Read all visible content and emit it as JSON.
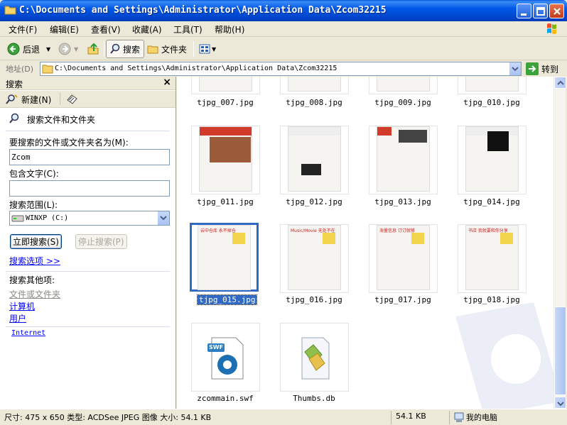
{
  "window": {
    "title": "C:\\Documents and Settings\\Administrator\\Application Data\\Zcom32215",
    "title_color": "#0058E6"
  },
  "menu": {
    "items": [
      "文件(F)",
      "编辑(E)",
      "查看(V)",
      "收藏(A)",
      "工具(T)",
      "帮助(H)"
    ]
  },
  "toolbar": {
    "back_label": "后退",
    "search_label": "搜索",
    "folders_label": "文件夹"
  },
  "address": {
    "label": "地址(D)",
    "value": "C:\\Documents and Settings\\Administrator\\Application Data\\Zcom32215",
    "go_label": "转到"
  },
  "search_pane": {
    "title": "搜索",
    "new_label": "新建(N)",
    "section_title": "搜索文件和文件夹",
    "filename_label": "要搜索的文件或文件夹名为(M):",
    "filename_value": "Zcom",
    "contains_label": "包含文字(C):",
    "contains_value": "",
    "scope_label": "搜索范围(L):",
    "scope_value": "WINXP (C:)",
    "search_button": "立即搜索(S)",
    "stop_button": "停止搜索(P)",
    "options_link": "搜索选项 >>",
    "other_title": "搜索其他项:",
    "other_items": [
      "文件或文件夹",
      "计算机",
      "用户"
    ],
    "internet_link": "Internet"
  },
  "files": [
    {
      "name": "tjpg_007.jpg",
      "kind": "jpg-cropped"
    },
    {
      "name": "tjpg_008.jpg",
      "kind": "jpg-cropped"
    },
    {
      "name": "tjpg_009.jpg",
      "kind": "jpg-cropped"
    },
    {
      "name": "tjpg_010.jpg",
      "kind": "jpg-cropped"
    },
    {
      "name": "tjpg_011.jpg",
      "kind": "jpg"
    },
    {
      "name": "tjpg_012.jpg",
      "kind": "jpg"
    },
    {
      "name": "tjpg_013.jpg",
      "kind": "jpg"
    },
    {
      "name": "tjpg_014.jpg",
      "kind": "jpg"
    },
    {
      "name": "tjpg_015.jpg",
      "kind": "jpg",
      "selected": true,
      "headline": "云中仓库 永不掉仓"
    },
    {
      "name": "tjpg_016.jpg",
      "kind": "jpg",
      "headline": "Music/Movie 无处不在"
    },
    {
      "name": "tjpg_017.jpg",
      "kind": "jpg",
      "headline": "海量信息 订订就够"
    },
    {
      "name": "tjpg_018.jpg",
      "kind": "jpg",
      "headline": "书店 我就要和你分享"
    },
    {
      "name": "zcommain.swf",
      "kind": "swf",
      "badge": "SWF"
    },
    {
      "name": "Thumbs.db",
      "kind": "db"
    }
  ],
  "status": {
    "info": "尺寸: 475 x 650 类型: ACDSee JPEG 图像 大小: 54.1 KB",
    "size": "54.1 KB",
    "location": "我的电脑"
  },
  "colors": {
    "selection": "#316AC5",
    "link": "#0000FF",
    "chrome": "#ECE9D8"
  }
}
